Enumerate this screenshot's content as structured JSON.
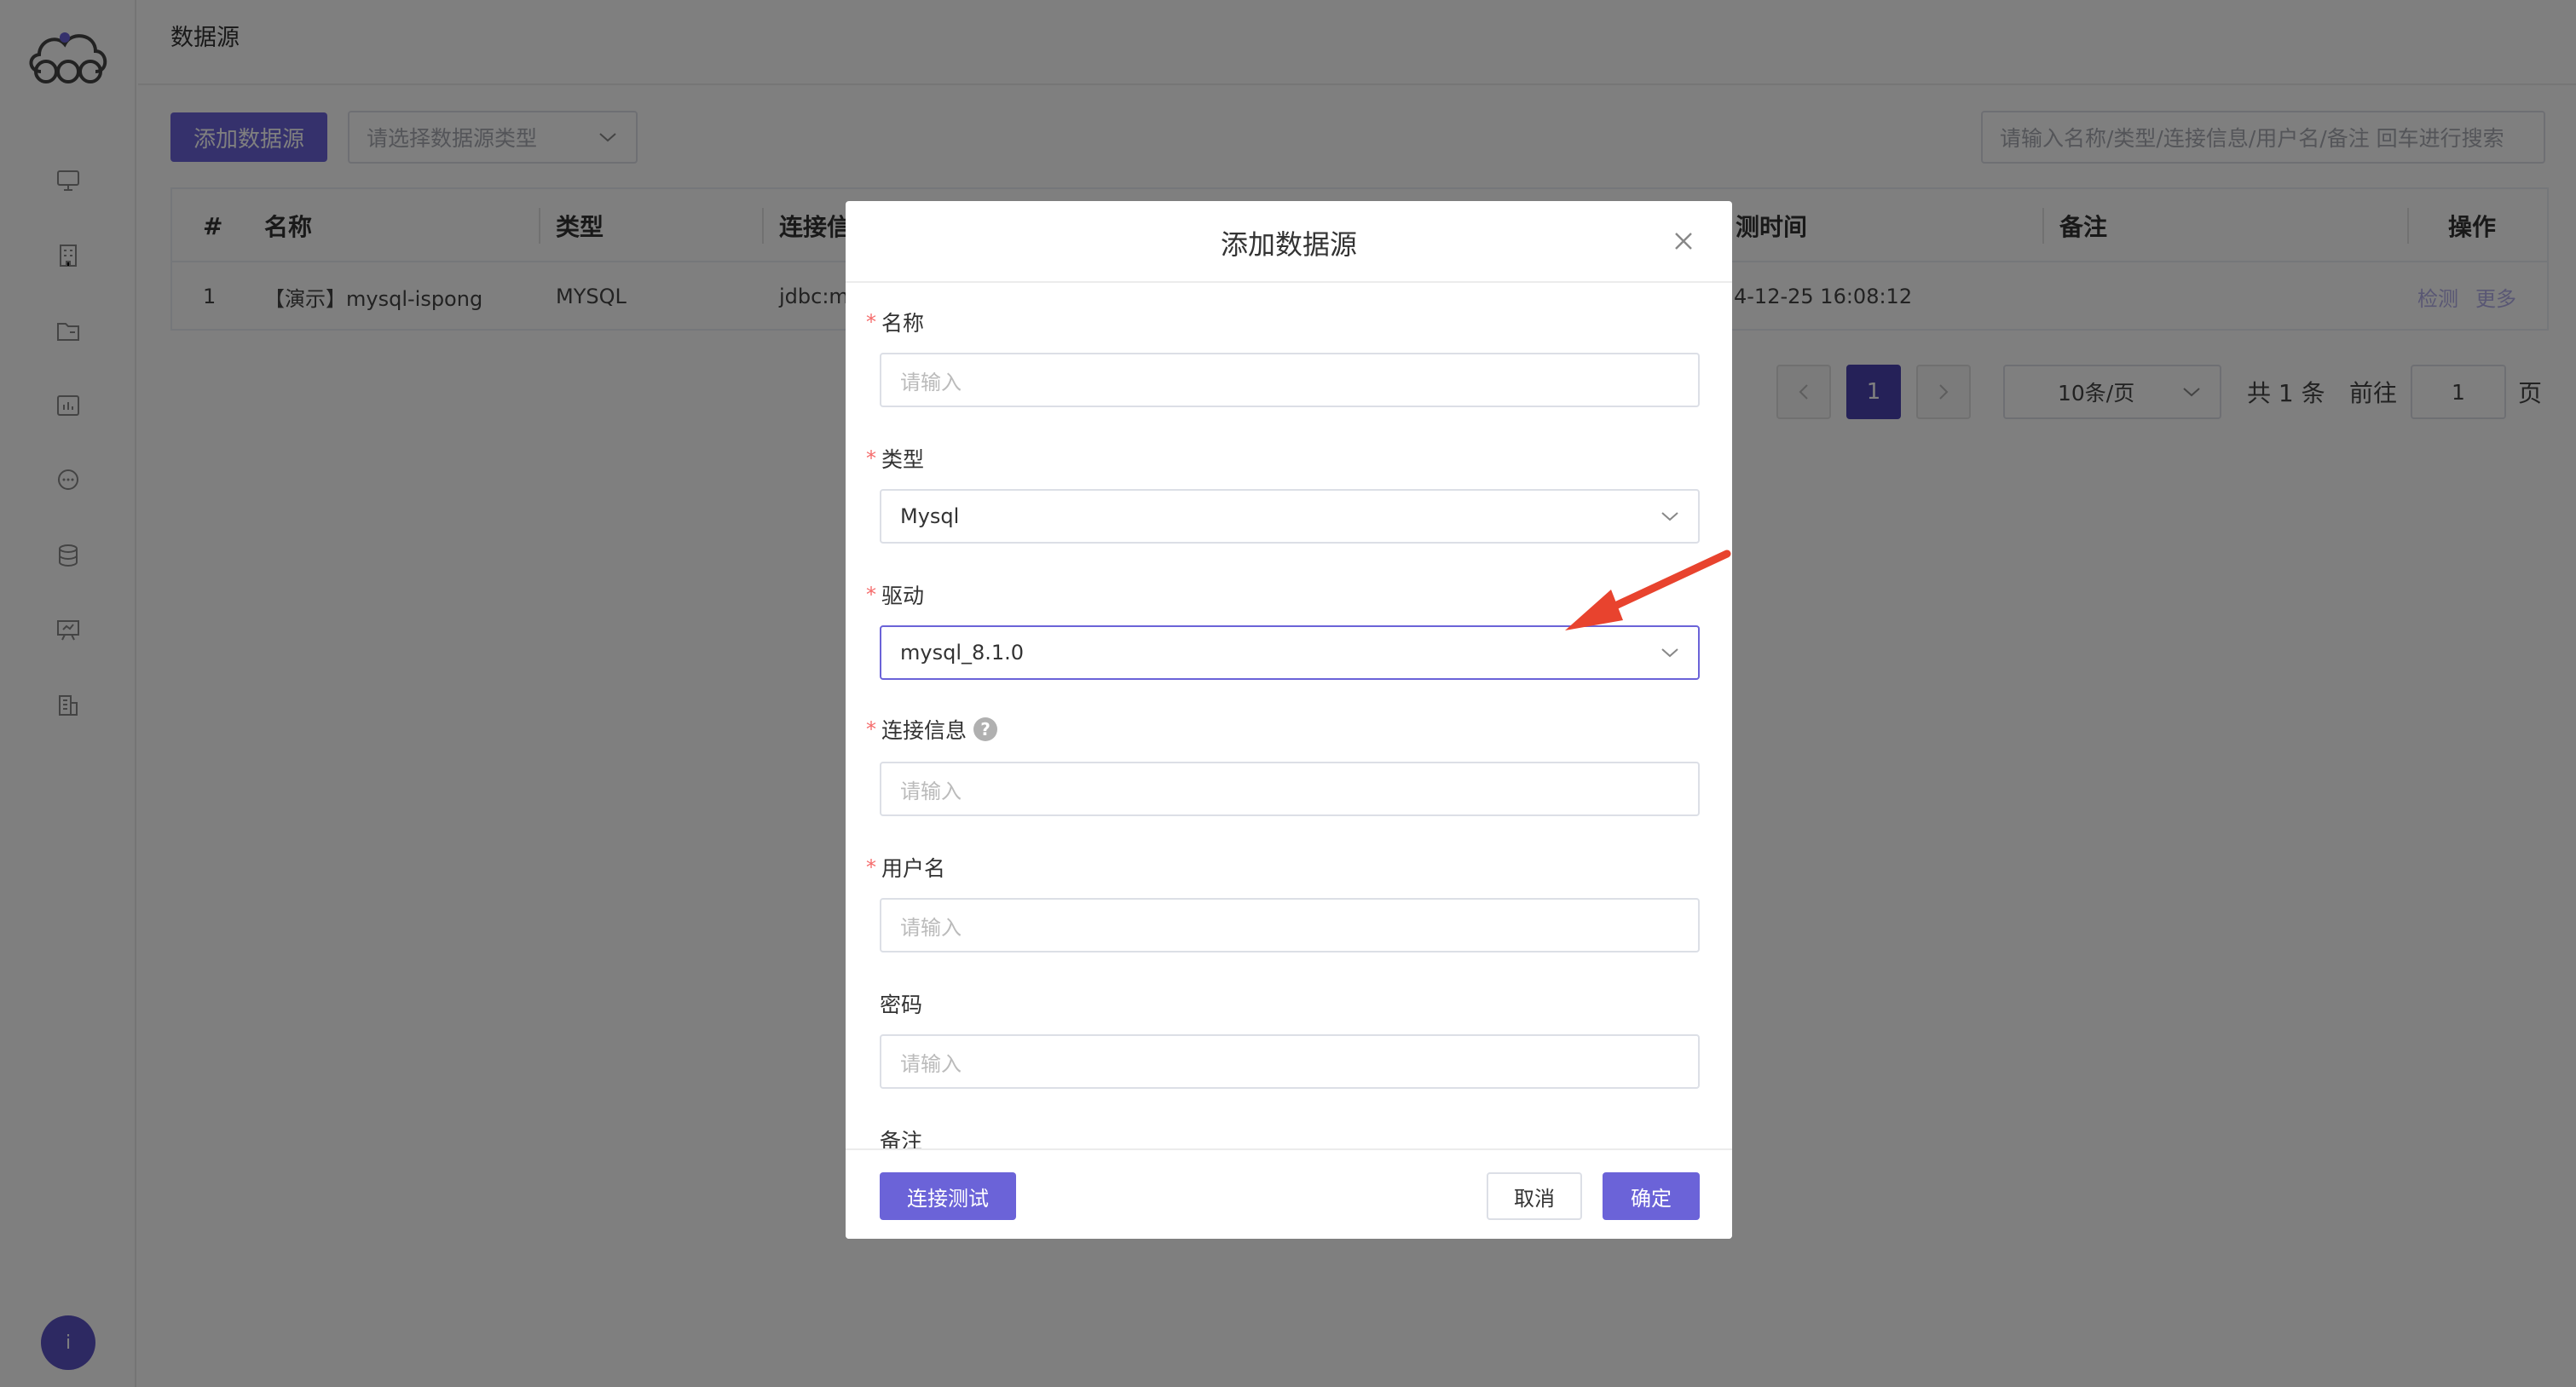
{
  "header": {
    "title": "数据源"
  },
  "toolbar": {
    "add_label": "添加数据源",
    "type_select_placeholder": "请选择数据源类型",
    "search_placeholder": "请输入名称/类型/连接信息/用户名/备注 回车进行搜索"
  },
  "table": {
    "columns": [
      "#",
      "名称",
      "类型",
      "连接信",
      "测时间",
      "备注",
      "操作"
    ],
    "rows": [
      {
        "index": "1",
        "name": "【演示】mysql-ispong",
        "type": "MYSQL",
        "conn": "jdbc:m",
        "time": "4-12-25 16:08:12",
        "remark": "",
        "actions": [
          "检测",
          "更多"
        ]
      }
    ]
  },
  "pagination": {
    "current": "1",
    "page_size": "10条/页",
    "total": "共 1 条",
    "goto_label": "前往",
    "goto_value": "1",
    "page_suffix": "页"
  },
  "dialog": {
    "title": "添加数据源",
    "fields": {
      "name": {
        "label": "名称",
        "placeholder": "请输入"
      },
      "type": {
        "label": "类型",
        "value": "Mysql"
      },
      "driver": {
        "label": "驱动",
        "value": "mysql_8.1.0"
      },
      "conn": {
        "label": "连接信息",
        "placeholder": "请输入"
      },
      "user": {
        "label": "用户名",
        "placeholder": "请输入"
      },
      "password": {
        "label": "密码",
        "placeholder": "请输入"
      },
      "remark": {
        "label": "备注"
      }
    },
    "required_mark": "*",
    "help_mark": "?",
    "test_label": "连接测试",
    "cancel_label": "取消",
    "ok_label": "确定"
  },
  "user": {
    "avatar_initial": "i"
  },
  "colors": {
    "accent": "#6b63d8",
    "arrow": "#e8432e"
  },
  "icons": [
    "monitor-icon",
    "building-icon",
    "folder-icon",
    "chart-icon",
    "chat-icon",
    "database-icon",
    "presentation-icon",
    "office-icon"
  ]
}
